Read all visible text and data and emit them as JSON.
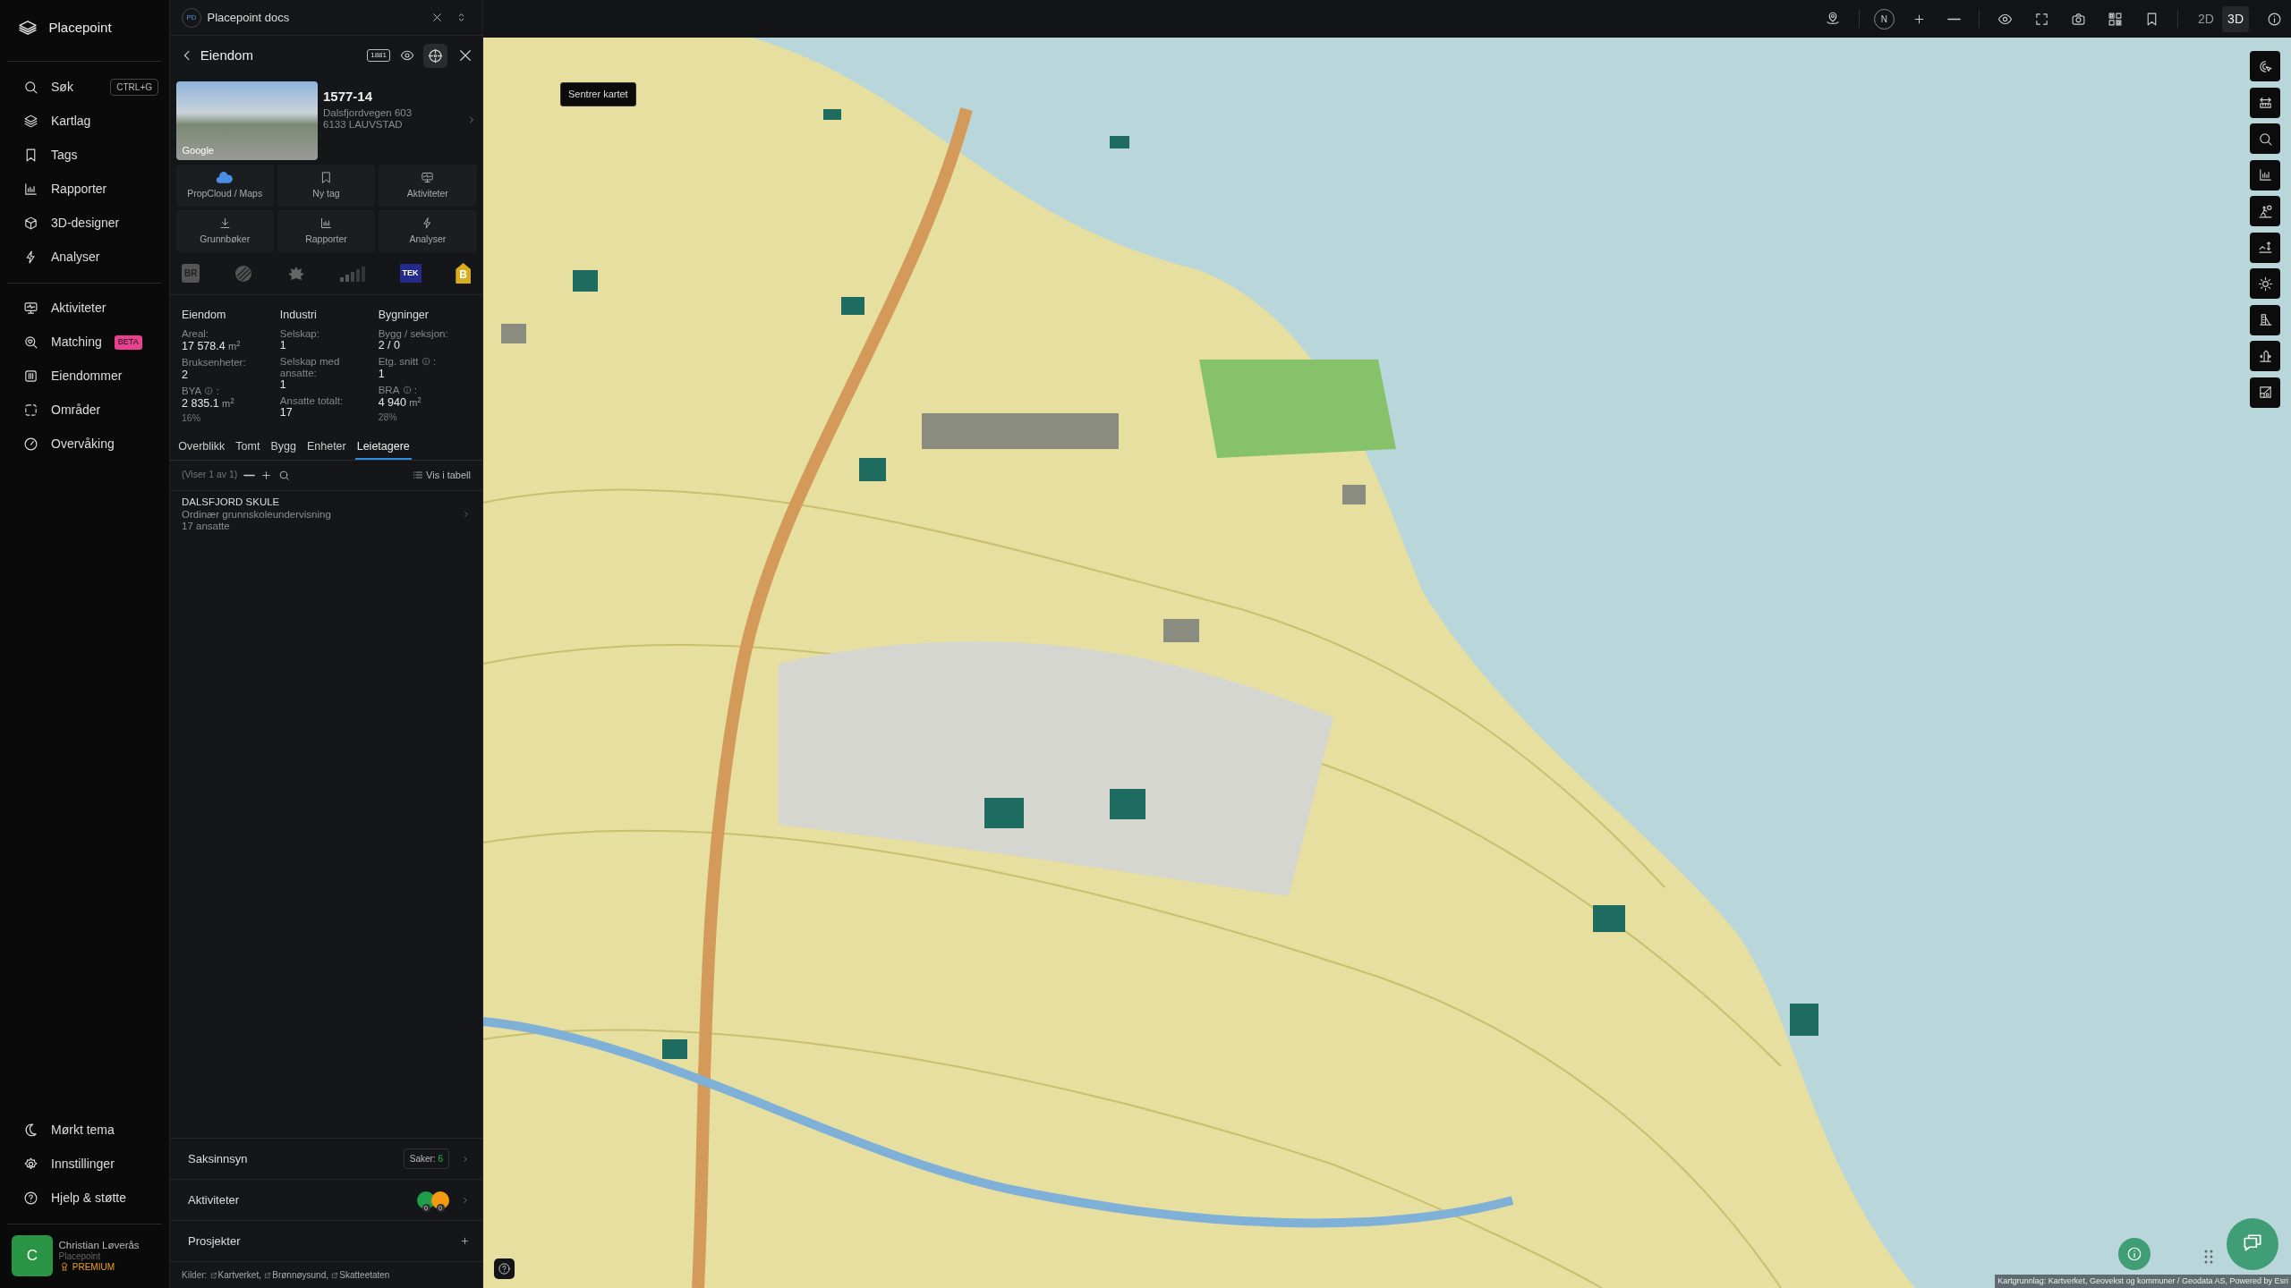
{
  "sidebar": {
    "brand": "Placepoint",
    "items": [
      {
        "label": "Søk",
        "shortcut": "CTRL+G",
        "selected": false
      },
      {
        "label": "Kartlag",
        "selected": false
      },
      {
        "label": "Tags",
        "selected": false
      },
      {
        "label": "Rapporter",
        "selected": false
      },
      {
        "label": "3D-designer",
        "selected": false
      },
      {
        "label": "Analyser",
        "selected": false
      }
    ],
    "items_2": [
      {
        "label": "Aktiviteter",
        "selected": false
      },
      {
        "label": "Matching",
        "badge": "BETA",
        "selected": false
      },
      {
        "label": "Eiendommer",
        "selected": false
      },
      {
        "label": "Områder",
        "selected": false
      },
      {
        "label": "Overvåking",
        "selected": false
      }
    ],
    "bottom_items": [
      {
        "label": "Mørkt tema",
        "selected": false
      },
      {
        "label": "Innstillinger",
        "selected": false
      },
      {
        "label": "Hjelp & støtte",
        "selected": false
      }
    ],
    "user": {
      "initial": "C",
      "name": "Christian Løverås",
      "org": "Placepoint",
      "plan": "PREMIUM"
    }
  },
  "panel": {
    "workspace": {
      "initials": "PD",
      "title": "Placepoint docs"
    },
    "header": {
      "title": "Eiendom",
      "badge": "1881"
    },
    "tooltip": "Sentrer kartet",
    "property": {
      "title": "1577-14",
      "address": "Dalsfjordvegen 603",
      "postal": "6133 LAUVSTAD",
      "photo_label": "Google"
    },
    "actions": [
      {
        "label": "PropCloud / Maps"
      },
      {
        "label": "Ny tag"
      },
      {
        "label": "Aktiviteter"
      },
      {
        "label": "Grunnbøker"
      },
      {
        "label": "Rapporter"
      },
      {
        "label": "Analyser"
      }
    ],
    "registry_logos": [
      {
        "kind": "br",
        "label": "BR"
      },
      {
        "kind": "stripes"
      },
      {
        "kind": "crest"
      },
      {
        "kind": "bars"
      },
      {
        "kind": "tek",
        "label": "TEK"
      },
      {
        "kind": "energy",
        "label": "B"
      }
    ],
    "stats": [
      {
        "heading": "Eiendom",
        "fields": [
          {
            "label": "Areal:",
            "value": "17 578.4",
            "unit": "m$^{2}$"
          },
          {
            "label": "Bruksenheter:",
            "value": "2"
          },
          {
            "label": "BYA",
            "info": true,
            "info_suffix": ":",
            "value": "2 835.1",
            "unit": "m$^{2}$",
            "note": "16%"
          }
        ]
      },
      {
        "heading": "Industri",
        "fields": [
          {
            "label": "Selskap:",
            "value": "1"
          },
          {
            "label": "Selskap med ansatte:",
            "value": "1"
          },
          {
            "label": "Ansatte totalt:",
            "value": "17"
          }
        ]
      },
      {
        "heading": "Bygninger",
        "fields": [
          {
            "label": "Bygg / seksjon:",
            "value": "2 / 0"
          },
          {
            "label": "Etg. snitt",
            "info": true,
            "info_suffix": ":",
            "value": "1"
          },
          {
            "label": "BRA",
            "info": true,
            "info_suffix": ":",
            "value": "4 940",
            "unit": "m$^{2}$",
            "note": "28%"
          }
        ]
      }
    ],
    "tabs": [
      {
        "label": "Overblikk",
        "selected": false
      },
      {
        "label": "Tomt",
        "selected": false
      },
      {
        "label": "Bygg",
        "selected": false
      },
      {
        "label": "Enheter",
        "selected": false
      },
      {
        "label": "Leietagere",
        "selected": true
      }
    ],
    "tenant_toolbar": {
      "count": "(Viser 1 av 1)",
      "table_link": "Vis i tabell"
    },
    "tenants": [
      {
        "name": "DALSFJORD SKULE",
        "description": "Ordinær grunnskoleundervisning",
        "employees": "17 ansatte"
      }
    ],
    "sections": [
      {
        "kind": "cases",
        "label": "Saksinnsyn",
        "count_label": "Saker:",
        "count": "6"
      },
      {
        "kind": "activities",
        "label": "Aktiviteter",
        "counters": [
          {
            "count": "0",
            "color": "#1e9e4a"
          },
          {
            "count": "0",
            "color": "#f29a12"
          }
        ]
      },
      {
        "kind": "projects",
        "label": "Prosjekter"
      }
    ],
    "sources": {
      "label": "Kilder:",
      "links": [
        "Kartverket,",
        "Brønnøysund,",
        "Skatteetaten"
      ]
    }
  },
  "map": {
    "compass_label": "N",
    "modes": [
      {
        "label": "2D",
        "selected": false
      },
      {
        "label": "3D",
        "selected": true
      }
    ],
    "attribution": "Kartgrunnlag: Kartverket, Geovekst og kommuner / Geodata AS, Powered by Esri"
  }
}
